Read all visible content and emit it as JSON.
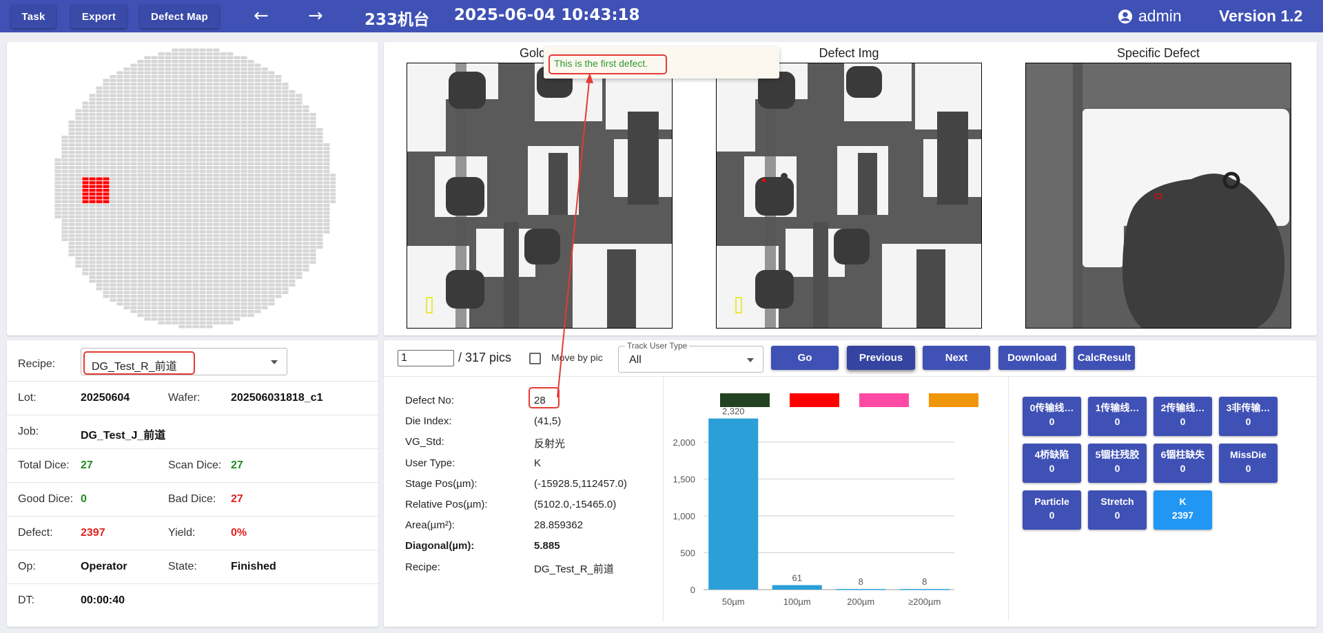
{
  "toolbar": {
    "task_label": "Task",
    "export_label": "Export",
    "defect_map_label": "Defect Map",
    "machine": "233机台",
    "datetime": "2025-06-04 10:43:18",
    "user": "admin",
    "version": "Version 1.2"
  },
  "images": {
    "golden_title": "Golden",
    "defect_title": "Defect Img",
    "specific_title": "Specific Defect"
  },
  "tooltip": {
    "text": "This is the first defect."
  },
  "info": {
    "recipe_label": "Recipe:",
    "recipe_value": "DG_Test_R_前道",
    "lot_label": "Lot:",
    "lot_value": "20250604",
    "wafer_label": "Wafer:",
    "wafer_value": "202506031818_c1",
    "job_label": "Job:",
    "job_value": "DG_Test_J_前道",
    "total_dice_label": "Total Dice:",
    "total_dice_value": "27",
    "scan_dice_label": "Scan Dice:",
    "scan_dice_value": "27",
    "good_dice_label": "Good Dice:",
    "good_dice_value": "0",
    "bad_dice_label": "Bad Dice:",
    "bad_dice_value": "27",
    "defect_label": "Defect:",
    "defect_value": "2397",
    "yield_label": "Yield:",
    "yield_value": "0%",
    "op_label": "Op:",
    "op_value": "Operator",
    "state_label": "State:",
    "state_value": "Finished",
    "dt_label": "DT:",
    "dt_value": "00:00:40"
  },
  "controls": {
    "page_value": "1",
    "pics_text": "/ 317 pics",
    "move_by_pic_label": "Move by pic",
    "track_label": "Track User Type",
    "track_value": "All",
    "go_label": "Go",
    "previous_label": "Previous",
    "next_label": "Next",
    "download_label": "Download",
    "calc_label": "CalcResult"
  },
  "details": [
    {
      "label": "Defect No:",
      "value": "28",
      "bold": false
    },
    {
      "label": "Die Index:",
      "value": "(41,5)",
      "bold": false
    },
    {
      "label": "VG_Std:",
      "value": "反射光",
      "bold": false
    },
    {
      "label": "User Type:",
      "value": "K",
      "bold": false
    },
    {
      "label": "Stage Pos(µm):",
      "value": "(-15928.5,112457.0)",
      "bold": false
    },
    {
      "label": "Relative Pos(µm):",
      "value": "(5102.0,-15465.0)",
      "bold": false
    },
    {
      "label": "Area(µm²):",
      "value": "28.859362",
      "bold": false
    },
    {
      "label": "Diagonal(µm):",
      "value": "5.885",
      "bold": true
    },
    {
      "label": "Recipe:",
      "value": "DG_Test_R_前道",
      "bold": false
    }
  ],
  "chart_data": {
    "type": "bar",
    "categories": [
      "50µm",
      "100µm",
      "200µm",
      "≥200µm"
    ],
    "values": [
      2320,
      61,
      8,
      8
    ],
    "data_labels": [
      "2,320",
      "61",
      "8",
      "8"
    ],
    "yticks": [
      "0",
      "500",
      "1,000",
      "1,500",
      "2,000"
    ],
    "ylim": [
      0,
      2400
    ],
    "bar_color": "#2a9fd8",
    "legend_colors": [
      "#234221",
      "#ff0000",
      "#ff4aa5",
      "#f0960a"
    ],
    "legend_position": "top",
    "grid": true
  },
  "categories": [
    {
      "name": "0传输线…",
      "count": "0",
      "active": false
    },
    {
      "name": "1传输线…",
      "count": "0",
      "active": false
    },
    {
      "name": "2传输线…",
      "count": "0",
      "active": false
    },
    {
      "name": "3非传输…",
      "count": "0",
      "active": false
    },
    {
      "name": "4桥缺陷",
      "count": "0",
      "active": false
    },
    {
      "name": "5锢柱残胶",
      "count": "0",
      "active": false
    },
    {
      "name": "6锢柱缺失",
      "count": "0",
      "active": false
    },
    {
      "name": "MissDie",
      "count": "0",
      "active": false
    },
    {
      "name": "Particle",
      "count": "0",
      "active": false
    },
    {
      "name": "Stretch",
      "count": "0",
      "active": false
    },
    {
      "name": "K",
      "count": "2397",
      "active": true
    }
  ],
  "colors": {
    "primary": "#3f51b5",
    "accent": "#2196f3",
    "highlight": "#e53935",
    "good": "#1e8c1e",
    "bad": "#e02020",
    "defect_die": "#ff0000"
  }
}
